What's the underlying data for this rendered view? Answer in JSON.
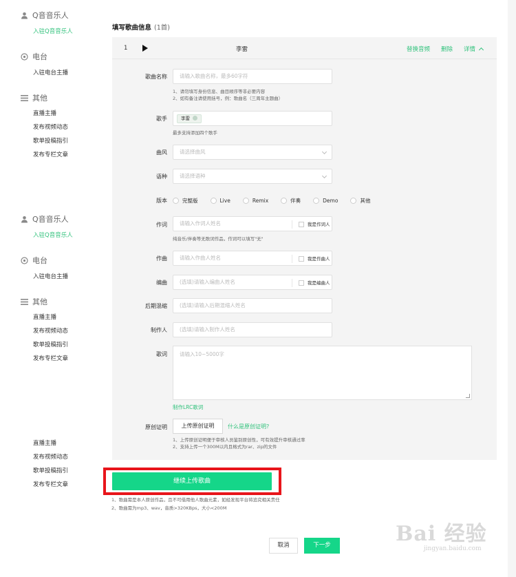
{
  "sidebar": {
    "groups_1": {
      "music_head": "Q音音乐人",
      "music_sub": "入驻Q音音乐人",
      "radio_head": "电台",
      "radio_sub": "入驻电台主播",
      "other_head": "其他",
      "other_items": [
        "直播主播",
        "发布视频动态",
        "歌单投稿指引",
        "发布专栏文章"
      ]
    },
    "groups_2": {
      "music_head": "Q音音乐人",
      "music_sub": "入驻Q音音乐人",
      "radio_head": "电台",
      "radio_sub": "入驻电台主播",
      "other_head": "其他",
      "other_items": [
        "直播主播",
        "发布视频动态",
        "歌单投稿指引",
        "发布专栏文章"
      ]
    },
    "tail_items": [
      "直播主播",
      "发布视频动态",
      "歌单投稿指引",
      "发布专栏文章"
    ]
  },
  "form": {
    "title": "填写歌曲信息",
    "count": "(1首)",
    "song": {
      "index": "1",
      "name": "李雷",
      "replace": "替换音频",
      "delete": "删除",
      "detail": "详情"
    },
    "song_name": {
      "label": "歌曲名称",
      "placeholder": "请输入歌曲名称，最多60字符",
      "hints": [
        "1、请勿填写身份信息、曲目顺序等非必要内容",
        "2、如有备注请使用括号，例：歌曲名（三周年主题曲）"
      ]
    },
    "singer": {
      "label": "歌手",
      "tag": "李雷",
      "hint": "最多支持添加四个歌手"
    },
    "genre": {
      "label": "曲风",
      "placeholder": "请选择曲风"
    },
    "language": {
      "label": "语种",
      "placeholder": "请选择语种"
    },
    "version": {
      "label": "版本",
      "options": [
        "完整版",
        "Live",
        "Remix",
        "伴奏",
        "Demo",
        "其他"
      ]
    },
    "lyricist": {
      "label": "作词",
      "placeholder": "请输入作词人姓名",
      "check": "我是作词人",
      "hint": "纯音乐/伴奏等无歌词作品，作词可以填写\"无\""
    },
    "composer": {
      "label": "作曲",
      "placeholder": "请输入作曲人姓名",
      "check": "我是作曲人"
    },
    "arranger": {
      "label": "编曲",
      "placeholder": "(选填)请输入编曲人姓名",
      "check": "我是编曲人"
    },
    "mixer": {
      "label": "后期混缩",
      "placeholder": "(选填)请输入后期混缩人姓名"
    },
    "producer": {
      "label": "制作人",
      "placeholder": "(选填)请输入制作人姓名"
    },
    "lyrics": {
      "label": "歌词",
      "placeholder": "请输入10~5000字",
      "lrc_link": "制作LRC歌词"
    },
    "original": {
      "label": "原创证明",
      "upload": "上传原创证明",
      "what": "什么是原创证明?",
      "hints": [
        "1、上传原创证明便于审核人员鉴别原创性，可有效提升审核通过率",
        "2、支持上传一个300M以内且格式为rar、zip的文件"
      ]
    }
  },
  "continue_button": "继续上传歌曲",
  "bottom_hints": [
    "1、歌曲需是本人原创作品，且不可借用他人歌曲元素，如经发现平台将追究相关责任",
    "2、歌曲需为mp3、wav，音质>320KBps，大小<200M"
  ],
  "footer": {
    "cancel": "取消",
    "next": "下一步"
  },
  "watermark": {
    "brand": "Bai 经验",
    "url": "jingyan.baidu.com"
  },
  "colors": {
    "accent": "#31c27c",
    "button_green": "#15d689",
    "highlight_red": "#e8151b"
  }
}
